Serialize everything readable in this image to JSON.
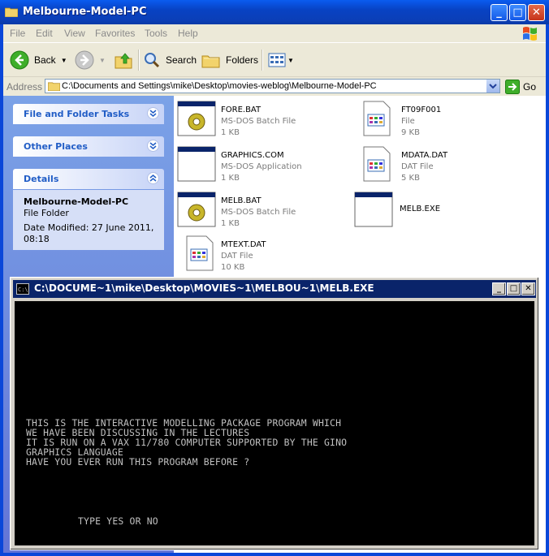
{
  "explorer": {
    "title": "Melbourne-Model-PC",
    "menu": [
      "File",
      "Edit",
      "View",
      "Favorites",
      "Tools",
      "Help"
    ],
    "toolbar": {
      "back": "Back",
      "search": "Search",
      "folders": "Folders"
    },
    "address": {
      "label": "Address",
      "path": "C:\\Documents and Settings\\mike\\Desktop\\movies-weblog\\Melbourne-Model-PC",
      "go": "Go"
    },
    "tasks": {
      "file_folder_tasks": "File and Folder Tasks",
      "other_places": "Other Places",
      "details": "Details",
      "details_name": "Melbourne-Model-PC",
      "details_type": "File Folder",
      "details_modified_1": "Date Modified: 27 June 2011,",
      "details_modified_2": "08:18"
    },
    "files": [
      {
        "name": "FORE.BAT",
        "type": "MS-DOS Batch File",
        "size": "1 KB",
        "icon": "batch-file-icon"
      },
      {
        "name": "FT09F001",
        "type": "File",
        "size": "9 KB",
        "icon": "generic-file-icon"
      },
      {
        "name": "GRAPHICS.COM",
        "type": "MS-DOS Application",
        "size": "1 KB",
        "icon": "application-icon"
      },
      {
        "name": "MDATA.DAT",
        "type": "DAT File",
        "size": "5 KB",
        "icon": "generic-file-icon"
      },
      {
        "name": "MELB.BAT",
        "type": "MS-DOS Batch File",
        "size": "1 KB",
        "icon": "batch-file-icon"
      },
      {
        "name": "MELB.EXE",
        "type": "",
        "size": "",
        "icon": "application-icon"
      },
      {
        "name": "MTEXT.DAT",
        "type": "DAT File",
        "size": "10 KB",
        "icon": "generic-file-icon"
      }
    ]
  },
  "console": {
    "title": "C:\\DOCUME~1\\mike\\Desktop\\MOVIES~1\\MELBOU~1\\MELB.EXE",
    "lines": [
      "THIS IS THE INTERACTIVE MODELLING PACKAGE PROGRAM WHICH",
      "WE HAVE BEEN DISCUSSING IN THE LECTURES",
      "IT IS RUN ON A VAX 11/780 COMPUTER SUPPORTED BY THE GINO",
      "GRAPHICS LANGUAGE",
      "HAVE YOU EVER RUN THIS PROGRAM BEFORE ?"
    ],
    "prompt": "TYPE YES OR NO"
  },
  "colors": {
    "xp_blue": "#0a47d9",
    "taskpane_blue": "#6f8ce0",
    "console_title": "#0a246a",
    "console_text": "#c0c0c0"
  }
}
